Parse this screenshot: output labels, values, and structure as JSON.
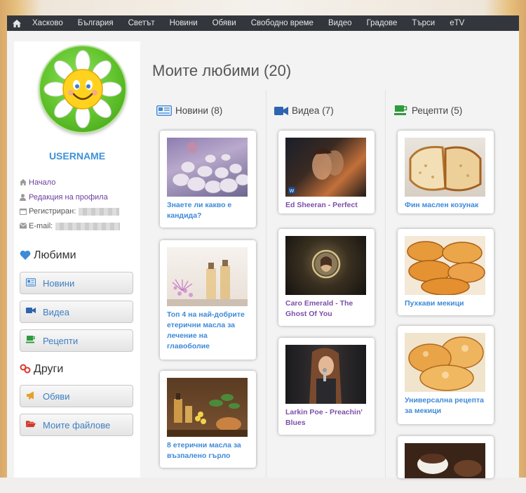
{
  "nav": {
    "home_icon": "home-icon",
    "items": [
      "Хасково",
      "България",
      "Светът",
      "Новини",
      "Обяви",
      "Свободно време",
      "Видео",
      "Градове",
      "Търси",
      "eTV"
    ]
  },
  "profile": {
    "username": "USERNAME",
    "links": {
      "home": "Начало",
      "edit_profile": "Редакция на профила",
      "registered_label": "Регистриран:",
      "email_label": "E-mail:"
    }
  },
  "favorites_section": {
    "title": "Любими",
    "buttons": [
      "Новини",
      "Видеа",
      "Рецепти"
    ]
  },
  "other_section": {
    "title": "Други",
    "buttons": [
      "Обяви",
      "Моите файлове"
    ]
  },
  "main": {
    "title": "Моите любими (20)",
    "columns": [
      {
        "label": "Новини (8)",
        "icon": "newspaper-icon",
        "items": [
          "Знаете ли какво е кандида?",
          "Топ 4 на най-добрите етерични масла за лечение на главоболие",
          "8 етерични масла за възпалено гърло"
        ]
      },
      {
        "label": "Видеа (7)",
        "icon": "video-camera-icon",
        "items": [
          "Ed Sheeran - Perfect",
          "Caro Emerald - The Ghost Of You",
          "Larkin Poe - Preachin' Blues"
        ]
      },
      {
        "label": "Рецепти (5)",
        "icon": "coffee-cup-icon",
        "items": [
          "Фин маслен козунак",
          "Пухкави мекици",
          "Универсална рецепта за мекици",
          ""
        ]
      }
    ]
  },
  "colors": {
    "navbar": "#33373d",
    "accent_blue": "#3d8ad8",
    "video_purple": "#7d4fa8",
    "news_icon": "#3d8ad8",
    "video_icon": "#2f64b0",
    "recipe_icon": "#2e9b3e"
  }
}
